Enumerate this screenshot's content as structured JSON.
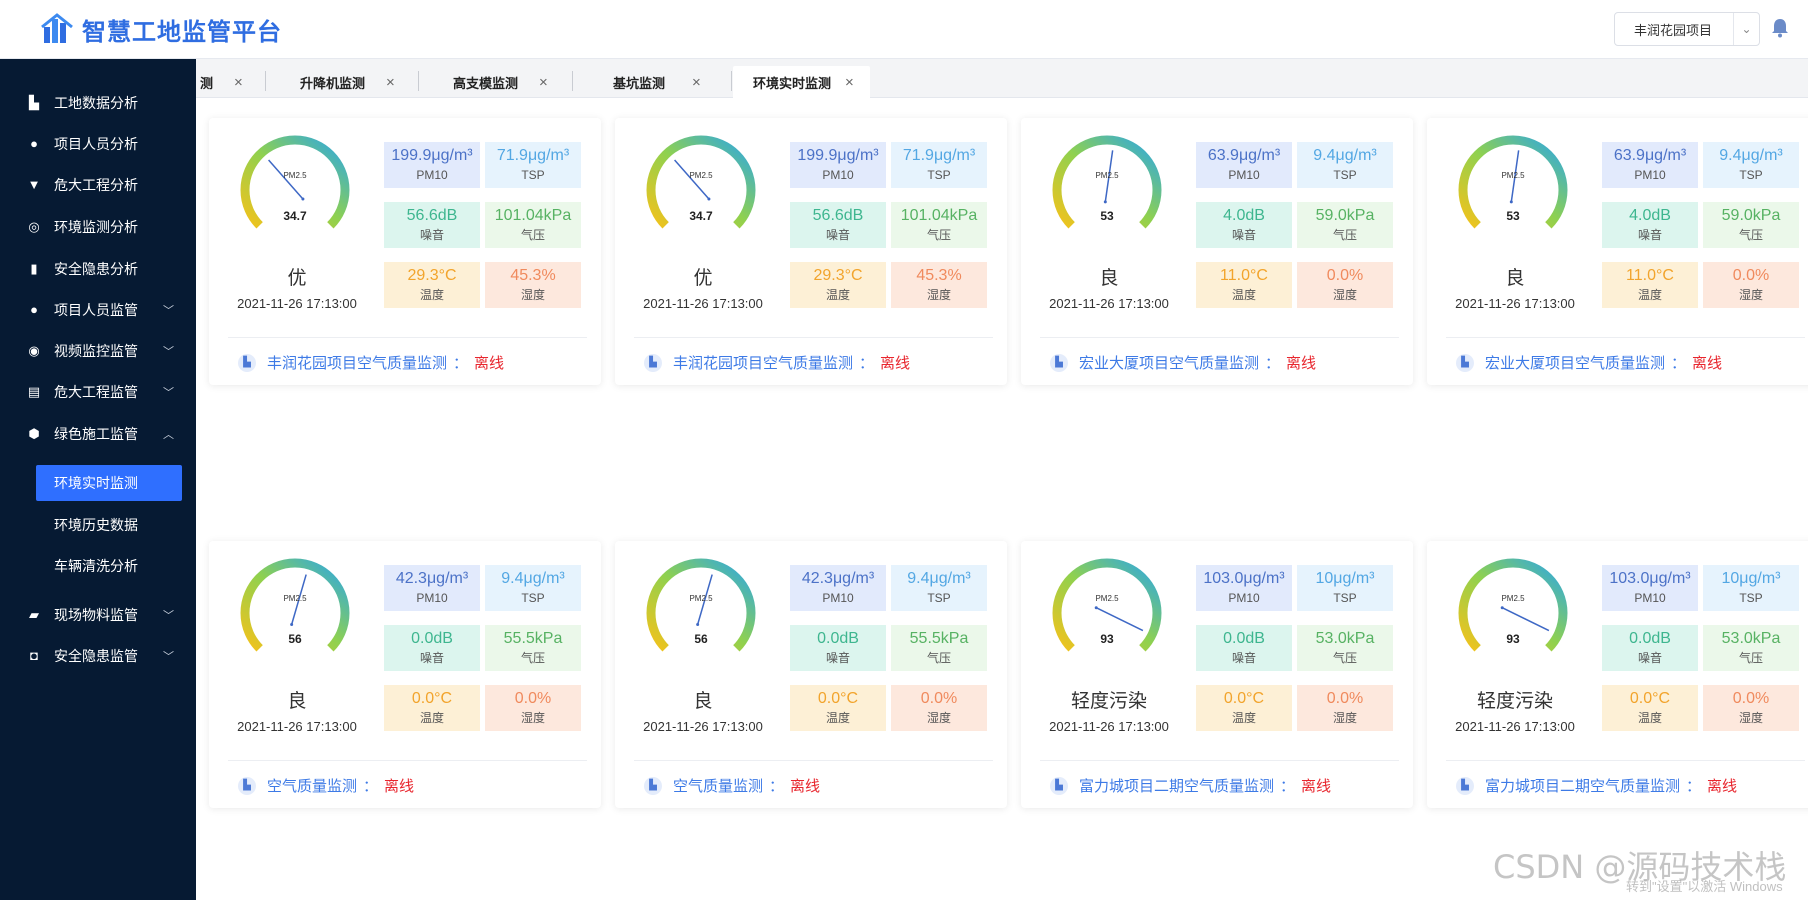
{
  "header": {
    "title": "智慧工地监管平台",
    "project_select": "丰润花园项目"
  },
  "sidebar": {
    "items": [
      {
        "label": "工地数据分析",
        "icon": "building-icon"
      },
      {
        "label": "项目人员分析",
        "icon": "person-icon"
      },
      {
        "label": "危大工程分析",
        "icon": "funnel-icon"
      },
      {
        "label": "环境监测分析",
        "icon": "globe-icon"
      },
      {
        "label": "安全隐患分析",
        "icon": "bar-chart-icon"
      },
      {
        "label": "项目人员监管",
        "icon": "person-icon"
      },
      {
        "label": "视频监控监管",
        "icon": "camera-icon"
      },
      {
        "label": "危大工程监管",
        "icon": "layers-icon"
      },
      {
        "label": "绿色施工监管",
        "icon": "shield-icon"
      }
    ],
    "sub_items": [
      "环境实时监测",
      "环境历史数据",
      "车辆清洗分析"
    ],
    "bottom_items": [
      {
        "label": "现场物料监管",
        "icon": "truck-icon"
      },
      {
        "label": "安全隐患监管",
        "icon": "warning-icon"
      }
    ]
  },
  "tabs": [
    "测",
    "升降机监测",
    "高支模监测",
    "基坑监测",
    "环境实时监测"
  ],
  "labels": {
    "gauge": "PM2.5",
    "pm10": "PM10",
    "tsp": "TSP",
    "noise": "噪音",
    "pressure": "气压",
    "temperature": "温度",
    "humidity": "湿度",
    "colon": "："
  },
  "colors": {
    "sidebar_bg": "#061a33",
    "accent": "#2f6fff",
    "offline": "#e8262e"
  },
  "cards": [
    {
      "pm25": "34.7",
      "pm25_value": 34.7,
      "level": "优",
      "time": "2021-11-26 17:13:00",
      "pm10": "199.9μg/m³",
      "tsp": "71.9μg/m³",
      "noise": "56.6dB",
      "pressure": "101.04kPa",
      "temperature": "29.3°C",
      "humidity": "45.3%",
      "name": "丰润花园项目空气质量监测",
      "status": "离线"
    },
    {
      "pm25": "34.7",
      "pm25_value": 34.7,
      "level": "优",
      "time": "2021-11-26 17:13:00",
      "pm10": "199.9μg/m³",
      "tsp": "71.9μg/m³",
      "noise": "56.6dB",
      "pressure": "101.04kPa",
      "temperature": "29.3°C",
      "humidity": "45.3%",
      "name": "丰润花园项目空气质量监测",
      "status": "离线"
    },
    {
      "pm25": "53",
      "pm25_value": 53,
      "level": "良",
      "time": "2021-11-26 17:13:00",
      "pm10": "63.9μg/m³",
      "tsp": "9.4μg/m³",
      "noise": "4.0dB",
      "pressure": "59.0kPa",
      "temperature": "11.0°C",
      "humidity": "0.0%",
      "name": "宏业大厦项目空气质量监测",
      "status": "离线"
    },
    {
      "pm25": "53",
      "pm25_value": 53,
      "level": "良",
      "time": "2021-11-26 17:13:00",
      "pm10": "63.9μg/m³",
      "tsp": "9.4μg/m³",
      "noise": "4.0dB",
      "pressure": "59.0kPa",
      "temperature": "11.0°C",
      "humidity": "0.0%",
      "name": "宏业大厦项目空气质量监测",
      "status": "离线"
    },
    {
      "pm25": "56",
      "pm25_value": 56,
      "level": "良",
      "time": "2021-11-26 17:13:00",
      "pm10": "42.3μg/m³",
      "tsp": "9.4μg/m³",
      "noise": "0.0dB",
      "pressure": "55.5kPa",
      "temperature": "0.0°C",
      "humidity": "0.0%",
      "name": "空气质量监测",
      "status": "离线"
    },
    {
      "pm25": "56",
      "pm25_value": 56,
      "level": "良",
      "time": "2021-11-26 17:13:00",
      "pm10": "42.3μg/m³",
      "tsp": "9.4μg/m³",
      "noise": "0.0dB",
      "pressure": "55.5kPa",
      "temperature": "0.0°C",
      "humidity": "0.0%",
      "name": "空气质量监测",
      "status": "离线"
    },
    {
      "pm25": "93",
      "pm25_value": 93,
      "level": "轻度污染",
      "time": "2021-11-26 17:13:00",
      "pm10": "103.0μg/m³",
      "tsp": "10μg/m³",
      "noise": "0.0dB",
      "pressure": "53.0kPa",
      "temperature": "0.0°C",
      "humidity": "0.0%",
      "name": "富力城项目二期空气质量监测",
      "status": "离线"
    },
    {
      "pm25": "93",
      "pm25_value": 93,
      "level": "轻度污染",
      "time": "2021-11-26 17:13:00",
      "pm10": "103.0μg/m³",
      "tsp": "10μg/m³",
      "noise": "0.0dB",
      "pressure": "53.0kPa",
      "temperature": "0.0°C",
      "humidity": "0.0%",
      "name": "富力城项目二期空气质量监测",
      "status": "离线"
    }
  ],
  "watermark": "CSDN @源码技术栈",
  "windows_notice": "转到\"设置\"以激活 Windows"
}
